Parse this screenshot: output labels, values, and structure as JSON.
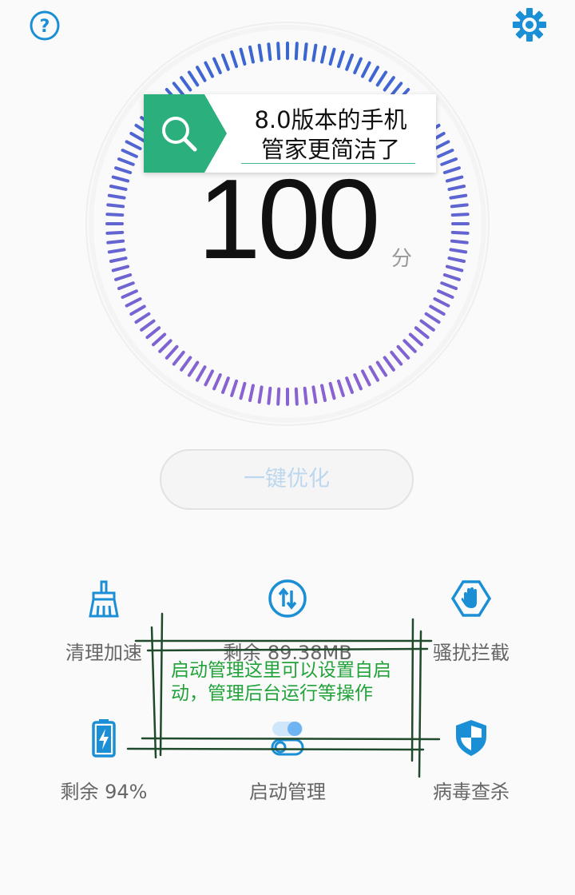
{
  "header": {
    "help_icon": "question-circle-icon",
    "settings_icon": "gear-icon"
  },
  "score": {
    "value": "100",
    "unit": "分",
    "level": 1.0
  },
  "tip": {
    "icon": "search-icon",
    "line1": "8.0版本的手机",
    "line2": "管家更简洁了"
  },
  "optimize_button": {
    "label": "一键优化"
  },
  "tools": [
    {
      "label": "清理加速",
      "icon": "broom-icon"
    },
    {
      "label": "剩余 89.38MB",
      "icon": "data-traffic-icon"
    },
    {
      "label": "骚扰拦截",
      "icon": "hand-block-icon"
    },
    {
      "label": "剩余 94%",
      "icon": "battery-icon"
    },
    {
      "label": "启动管理",
      "icon": "toggle-icon"
    },
    {
      "label": "病毒查杀",
      "icon": "shield-icon"
    }
  ],
  "annotation": {
    "text": "启动管理这里可以设置自启动，管理后台运行等操作"
  },
  "colors": {
    "accent": "#1a8fd6",
    "tag_green": "#2bb07d",
    "dial_top": "#3a66d0",
    "dial_bottom": "#8a63d2",
    "annotation": "#22a33a"
  }
}
